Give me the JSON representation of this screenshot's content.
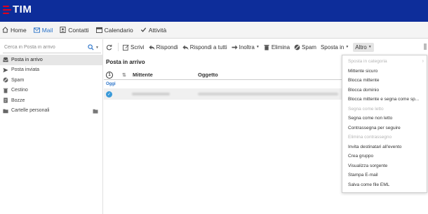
{
  "brand": {
    "name": "TIM",
    "logo_color": "#e2001a",
    "bar_color": "#0d2d9a"
  },
  "nav": {
    "items": [
      {
        "label": "Home",
        "icon": "home-icon"
      },
      {
        "label": "Mail",
        "icon": "mail-icon",
        "active": true
      },
      {
        "label": "Contatti",
        "icon": "contacts-icon"
      },
      {
        "label": "Calendario",
        "icon": "calendar-icon"
      },
      {
        "label": "Attività",
        "icon": "tasks-icon"
      }
    ]
  },
  "sidebar": {
    "search_placeholder": "Cerca in Posta in arrivo",
    "folders": [
      {
        "label": "Posta in arrivo",
        "icon": "inbox-icon",
        "active": true
      },
      {
        "label": "Posta inviata",
        "icon": "sent-icon"
      },
      {
        "label": "Spam",
        "icon": "spam-icon"
      },
      {
        "label": "Cestino",
        "icon": "trash-icon"
      },
      {
        "label": "Bozze",
        "icon": "drafts-icon"
      },
      {
        "label": "Cartelle personali",
        "icon": "folder-icon"
      }
    ]
  },
  "toolbar": {
    "refresh_icon": "refresh-icon",
    "compose": "Scrivi",
    "reply": "Rispondi",
    "reply_all": "Rispondi a tutti",
    "forward": "Inoltra",
    "delete": "Elimina",
    "spam": "Spam",
    "move": "Sposta in",
    "more": "Altro"
  },
  "list": {
    "folder_title": "Posta in arrivo",
    "col_sender": "Mittente",
    "col_subject": "Oggetto",
    "check_symbol": "1",
    "group_today": "Oggi"
  },
  "menu": {
    "items": [
      {
        "label": "Sposta in categoria",
        "disabled": true,
        "submenu": true
      },
      {
        "label": "Mittente sicuro"
      },
      {
        "label": "Blocca mittente"
      },
      {
        "label": "Blocca dominio"
      },
      {
        "label": "Blocca mittente e segna come sp..."
      },
      {
        "label": "Segna come letto",
        "disabled": true
      },
      {
        "label": "Segna come non letto"
      },
      {
        "label": "Contrassegna per seguire"
      },
      {
        "label": "Elimina contrassegno",
        "disabled": true
      },
      {
        "label": "Invita destinatari all'evento"
      },
      {
        "label": "Crea gruppo"
      },
      {
        "label": "Visualizza sorgente"
      },
      {
        "label": "Stampa E-mail"
      },
      {
        "label": "Salva come file EML"
      }
    ]
  }
}
